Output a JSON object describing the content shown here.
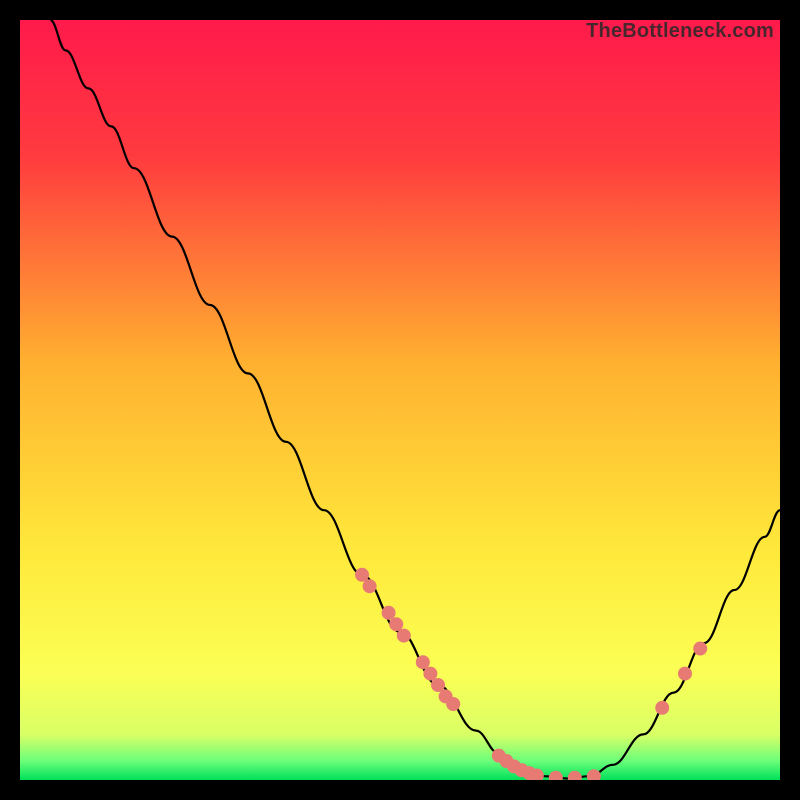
{
  "watermark": "TheBottleneck.com",
  "chart_data": {
    "type": "line",
    "title": "",
    "xlabel": "",
    "ylabel": "",
    "xlim": [
      0,
      100
    ],
    "ylim": [
      0,
      100
    ],
    "gradient_stops": [
      {
        "offset": 0.0,
        "color": "#ff1a4b"
      },
      {
        "offset": 0.18,
        "color": "#ff3b3f"
      },
      {
        "offset": 0.45,
        "color": "#ffb030"
      },
      {
        "offset": 0.7,
        "color": "#ffe93b"
      },
      {
        "offset": 0.86,
        "color": "#fbff55"
      },
      {
        "offset": 0.94,
        "color": "#d9ff66"
      },
      {
        "offset": 0.975,
        "color": "#6bff7a"
      },
      {
        "offset": 1.0,
        "color": "#00e05a"
      }
    ],
    "series": [
      {
        "name": "curve",
        "color": "#000000",
        "points": [
          {
            "x": 4.0,
            "y": 100.0
          },
          {
            "x": 6.0,
            "y": 96.0
          },
          {
            "x": 9.0,
            "y": 91.0
          },
          {
            "x": 12.0,
            "y": 86.0
          },
          {
            "x": 15.0,
            "y": 80.5
          },
          {
            "x": 20.0,
            "y": 71.5
          },
          {
            "x": 25.0,
            "y": 62.5
          },
          {
            "x": 30.0,
            "y": 53.5
          },
          {
            "x": 35.0,
            "y": 44.5
          },
          {
            "x": 40.0,
            "y": 35.5
          },
          {
            "x": 45.0,
            "y": 27.0
          },
          {
            "x": 50.0,
            "y": 19.5
          },
          {
            "x": 55.0,
            "y": 12.5
          },
          {
            "x": 60.0,
            "y": 6.5
          },
          {
            "x": 63.0,
            "y": 3.5
          },
          {
            "x": 66.0,
            "y": 1.5
          },
          {
            "x": 69.0,
            "y": 0.5
          },
          {
            "x": 72.0,
            "y": 0.2
          },
          {
            "x": 75.0,
            "y": 0.5
          },
          {
            "x": 78.0,
            "y": 2.0
          },
          {
            "x": 82.0,
            "y": 6.0
          },
          {
            "x": 86.0,
            "y": 11.5
          },
          {
            "x": 90.0,
            "y": 18.0
          },
          {
            "x": 94.0,
            "y": 25.0
          },
          {
            "x": 98.0,
            "y": 32.0
          },
          {
            "x": 100.0,
            "y": 35.5
          }
        ]
      },
      {
        "name": "dots",
        "color": "#e77b74",
        "radius": 7,
        "points": [
          {
            "x": 45.0,
            "y": 27.0
          },
          {
            "x": 46.0,
            "y": 25.5
          },
          {
            "x": 48.5,
            "y": 22.0
          },
          {
            "x": 49.5,
            "y": 20.5
          },
          {
            "x": 50.5,
            "y": 19.0
          },
          {
            "x": 53.0,
            "y": 15.5
          },
          {
            "x": 54.0,
            "y": 14.0
          },
          {
            "x": 55.0,
            "y": 12.5
          },
          {
            "x": 56.0,
            "y": 11.0
          },
          {
            "x": 57.0,
            "y": 10.0
          },
          {
            "x": 63.0,
            "y": 3.2
          },
          {
            "x": 64.0,
            "y": 2.5
          },
          {
            "x": 65.0,
            "y": 1.8
          },
          {
            "x": 66.0,
            "y": 1.3
          },
          {
            "x": 67.0,
            "y": 0.9
          },
          {
            "x": 68.0,
            "y": 0.6
          },
          {
            "x": 70.5,
            "y": 0.3
          },
          {
            "x": 73.0,
            "y": 0.3
          },
          {
            "x": 75.5,
            "y": 0.5
          },
          {
            "x": 84.5,
            "y": 9.5
          },
          {
            "x": 87.5,
            "y": 14.0
          },
          {
            "x": 89.5,
            "y": 17.3
          }
        ]
      }
    ]
  }
}
